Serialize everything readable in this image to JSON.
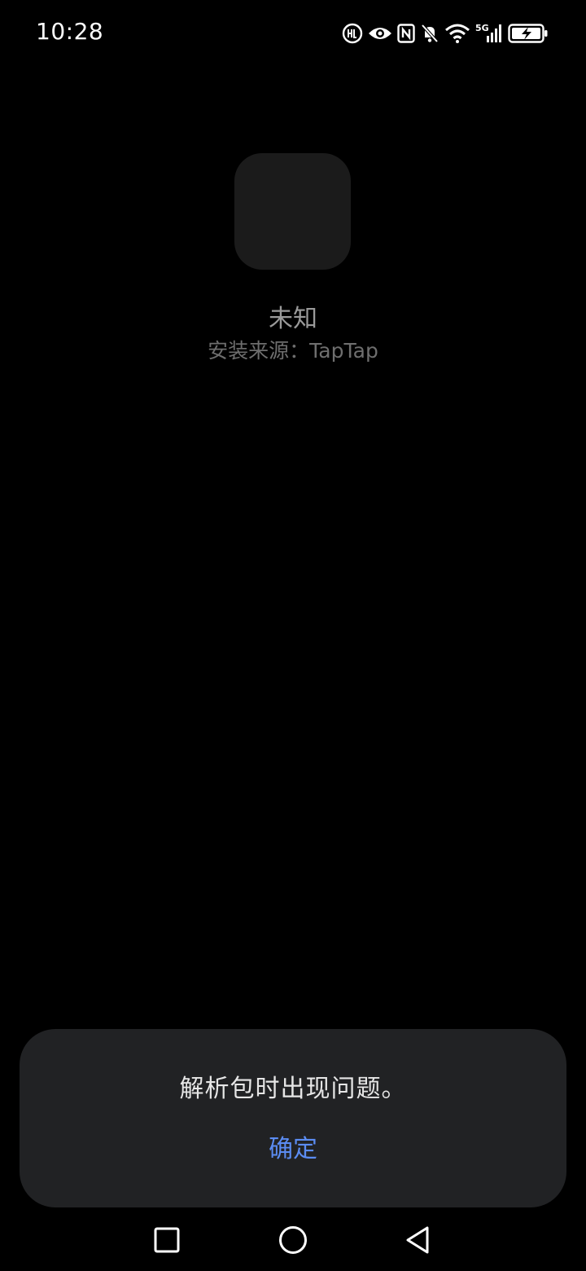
{
  "status_bar": {
    "time": "10:28",
    "icons": [
      "hd-call-icon",
      "eye-icon",
      "nfc-icon",
      "bell-off-icon",
      "wifi-icon",
      "signal-5g-icon",
      "battery-charging-icon"
    ]
  },
  "app": {
    "name": "未知",
    "install_source": "安装来源：TapTap"
  },
  "dialog": {
    "message": "解析包时出现问题。",
    "confirm_label": "确定"
  },
  "nav": {
    "icons": [
      "recents-square-icon",
      "home-circle-icon",
      "back-triangle-icon"
    ]
  },
  "colors": {
    "background": "#000000",
    "dialog_bg": "#212224",
    "accent": "#5b8cf2",
    "icon_placeholder": "#1b1b1b"
  }
}
